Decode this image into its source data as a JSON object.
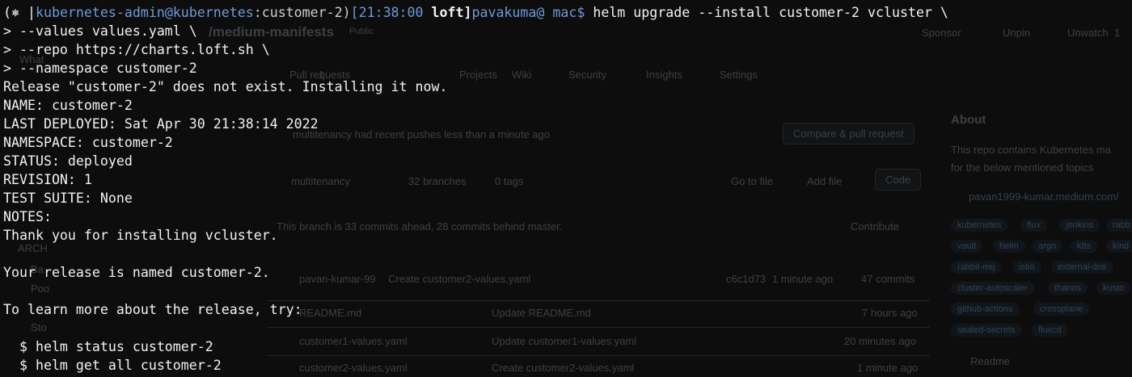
{
  "github": {
    "repo_name": "/medium-manifests",
    "visibility": "Public",
    "actions": [
      "Sponsor",
      "Unpin",
      "Unwatch",
      "1"
    ],
    "tabs": [
      "Pull requests",
      "1",
      "Projects",
      "Wiki",
      "Security",
      "Insights",
      "Settings"
    ],
    "push_notice": "multitenancy had recent pushes less than a minute ago",
    "compare_button": "Compare & pull request",
    "branch": "multitenancy",
    "branches": "32 branches",
    "tags": "0 tags",
    "go_to_file": "Go to file",
    "add_file": "Add file",
    "code": "Code",
    "ahead_behind": "This branch is 33 commits ahead, 28 commits behind master.",
    "contribute": "Contribute",
    "commit_author": "pavan-kumar-99",
    "commit_msg": "Create customer2-values.yaml",
    "commit_hash": "c6c1d73",
    "commit_time": "1 minute ago",
    "commits": "47 commits",
    "files": [
      {
        "name": "README.md",
        "msg": "Update README.md",
        "time": "7 hours ago"
      },
      {
        "name": "customer1-values.yaml",
        "msg": "Update customer1-values.yaml",
        "time": "20 minutes ago"
      },
      {
        "name": "customer2-values.yaml",
        "msg": "Create customer2-values.yaml",
        "time": "1 minute ago"
      }
    ],
    "about_title": "About",
    "about_text_1": "This repo contains Kubernetes ma",
    "about_text_2": "for the below mentioned topics",
    "about_link": "pavan1999-kumar.medium.com/",
    "topics": [
      "kubernetes",
      "flux",
      "jenkins",
      "rabb",
      "vault",
      "helm",
      "argo",
      "k8s",
      "kind",
      "rabbit-mq",
      "istio",
      "external-dns",
      "cluster-autoscaler",
      "thanos",
      "kusto",
      "github-actions",
      "crossplane",
      "sealed-secrets",
      "fluxcd"
    ],
    "readme_label": "Readme",
    "left_fragments": [
      "What",
      "ARCH",
      "Ba",
      "Poo",
      "Sto"
    ]
  },
  "terminal": {
    "prompt_prefix": "(⎈ |",
    "context": "kubernetes-admin@kubernetes",
    "namespace_ctx": ":customer-2)",
    "time": "[21:38:00 ",
    "cwd": "loft]",
    "user": "pavakuma@ mac$",
    "command": " helm upgrade --install customer-2 vcluster \\",
    "lines": [
      "> --values values.yaml \\",
      "> --repo https://charts.loft.sh \\",
      "> --namespace customer-2",
      "Release \"customer-2\" does not exist. Installing it now.",
      "NAME: customer-2",
      "LAST DEPLOYED: Sat Apr 30 21:38:14 2022",
      "NAMESPACE: customer-2",
      "STATUS: deployed",
      "REVISION: 1",
      "TEST SUITE: None",
      "NOTES:",
      "Thank you for installing vcluster.",
      "",
      "Your release is named customer-2.",
      "",
      "To learn more about the release, try:",
      "",
      "  $ helm status customer-2",
      "  $ helm get all customer-2"
    ]
  }
}
